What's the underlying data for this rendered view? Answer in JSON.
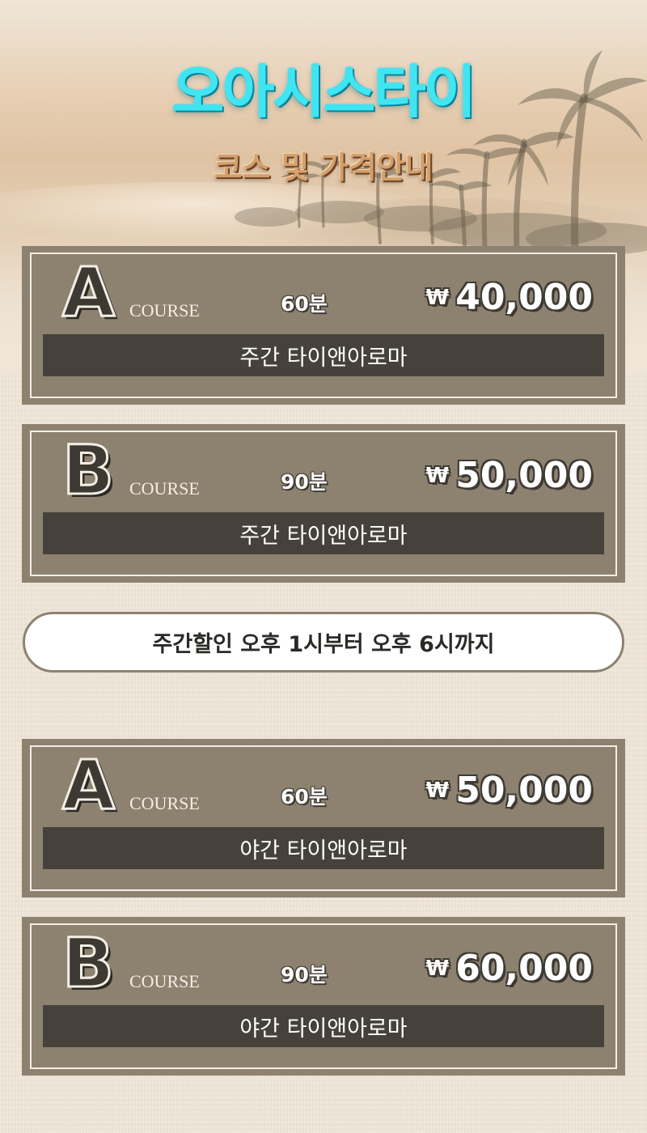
{
  "header": {
    "title": "오아시스타이",
    "subtitle": "코스 및 가격안내"
  },
  "sections": {
    "day": {
      "courses": [
        {
          "letter": "A",
          "course_label": "COURSE",
          "duration": "60분",
          "currency": "₩",
          "price": "40,000",
          "description": "주간 타이앤아로마"
        },
        {
          "letter": "B",
          "course_label": "COURSE",
          "duration": "90분",
          "currency": "₩",
          "price": "50,000",
          "description": "주간 타이앤아로마"
        }
      ]
    },
    "notice": "주간할인 오후 1시부터 오후 6시까지",
    "night": {
      "courses": [
        {
          "letter": "A",
          "course_label": "COURSE",
          "duration": "60분",
          "currency": "₩",
          "price": "50,000",
          "description": "야간 타이앤아로마"
        },
        {
          "letter": "B",
          "course_label": "COURSE",
          "duration": "90분",
          "currency": "₩",
          "price": "60,000",
          "description": "야간 타이앤아로마"
        }
      ]
    }
  },
  "colors": {
    "title": "#3fe6f2",
    "subtitle": "#d4a06b",
    "card_bg": "#8d8270",
    "bar_bg": "#46423b",
    "page_bg": "#efe6d8"
  }
}
